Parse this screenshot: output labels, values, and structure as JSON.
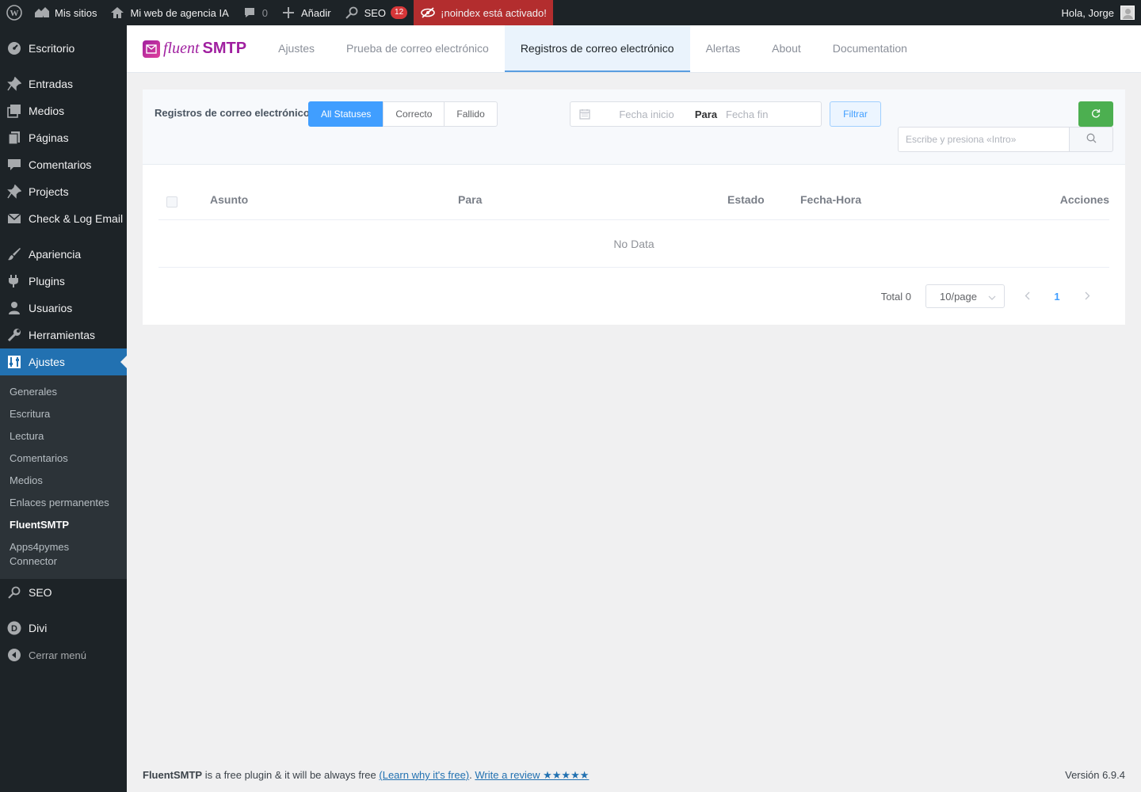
{
  "adminbar": {
    "my_sites": "Mis sitios",
    "site_name": "Mi web de agencia IA",
    "comments_count": "0",
    "add_new": "Añadir",
    "seo_label": "SEO",
    "seo_badge": "12",
    "noindex_notice": "¡noindex está activado!",
    "greeting": "Hola, Jorge"
  },
  "sidebar": {
    "items": [
      {
        "label": "Escritorio",
        "icon": "dashboard-icon"
      },
      {
        "label": "Entradas",
        "icon": "pin-icon"
      },
      {
        "label": "Medios",
        "icon": "media-icon"
      },
      {
        "label": "Páginas",
        "icon": "pages-icon"
      },
      {
        "label": "Comentarios",
        "icon": "comment-icon"
      },
      {
        "label": "Projects",
        "icon": "pin-icon"
      },
      {
        "label": "Check & Log Email",
        "icon": "mail-icon"
      },
      {
        "label": "Apariencia",
        "icon": "brush-icon"
      },
      {
        "label": "Plugins",
        "icon": "plugin-icon"
      },
      {
        "label": "Usuarios",
        "icon": "user-icon"
      },
      {
        "label": "Herramientas",
        "icon": "wrench-icon"
      },
      {
        "label": "Ajustes",
        "icon": "settings-icon"
      }
    ],
    "submenu": [
      "Generales",
      "Escritura",
      "Lectura",
      "Comentarios",
      "Medios",
      "Enlaces permanentes",
      "FluentSMTP",
      "Apps4pymes Connector"
    ],
    "after": [
      {
        "label": "SEO",
        "icon": "seo-icon"
      },
      {
        "label": "Divi",
        "icon": "divi-icon"
      }
    ],
    "collapse": "Cerrar menú"
  },
  "plugin_nav": {
    "brand_fluent": "fluent",
    "brand_smtp": "SMTP",
    "tabs": [
      "Ajustes",
      "Prueba de correo electrónico",
      "Registros de correo electrónico",
      "Alertas",
      "About",
      "Documentation"
    ],
    "active_tab": "Registros de correo electrónico"
  },
  "toolbar": {
    "label": "Registros de correo electrónico",
    "status_filters": [
      "All Statuses",
      "Correcto",
      "Fallido"
    ],
    "active_status": "All Statuses",
    "date_start_placeholder": "Fecha inicio",
    "date_separator": "Para",
    "date_end_placeholder": "Fecha fin",
    "filter_button": "Filtrar",
    "search_placeholder": "Escribe y presiona «Intro»"
  },
  "table": {
    "columns": [
      "Asunto",
      "Para",
      "Estado",
      "Fecha-Hora",
      "Acciones"
    ],
    "empty_text": "No Data"
  },
  "pagination": {
    "total": "Total 0",
    "page_size": "10/page",
    "current_page": "1"
  },
  "footer": {
    "brand": "FluentSMTP",
    "text": " is a free plugin & it will be always free ",
    "learn_link": "(Learn why it's free)",
    "review_link": "Write a review ★★★★★",
    "version": "Versión 6.9.4"
  },
  "colors": {
    "accent": "#2271b1",
    "primary": "#409eff",
    "refresh": "#4caf50",
    "noindex": "#b32d2e",
    "brand": "#a020a0"
  }
}
